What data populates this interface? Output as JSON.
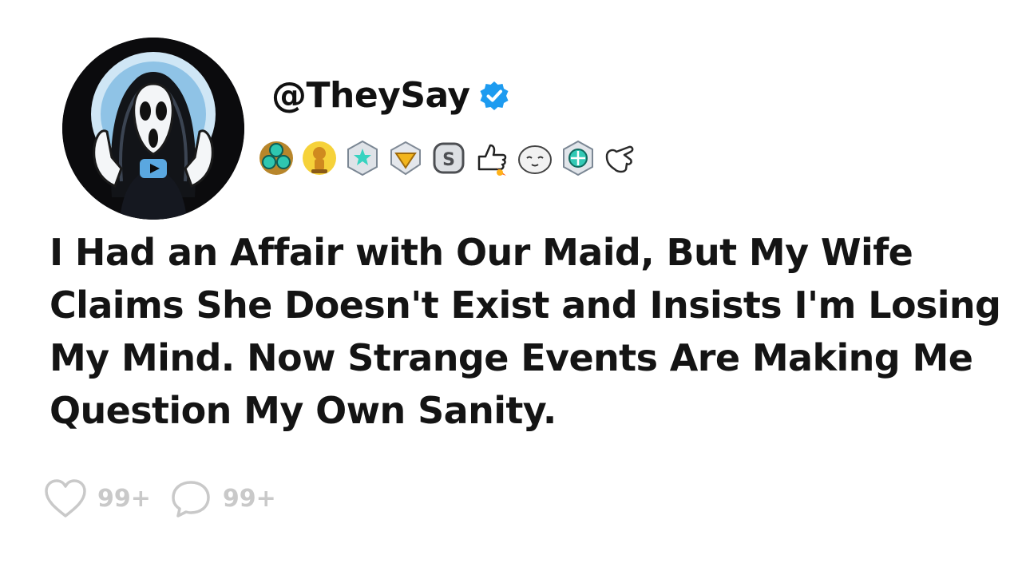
{
  "post": {
    "handle": "@TheySay",
    "verified": true,
    "title": "I Had an Affair with Our Maid, But My Wife Claims She Doesn't Exist and Insists I'm Losing My Mind. Now Strange Events Are Making Me Question My Own Sanity."
  },
  "avatar": {
    "icon": "ghostface-youtube-avatar-icon"
  },
  "awards": [
    "tri-gem-award-icon",
    "gold-snoo-trophy-award-icon",
    "silver-star-gem-award-icon",
    "gold-diamond-award-icon",
    "silver-s-coin-award-icon",
    "thumbs-up-rocket-award-icon",
    "seal-face-award-icon",
    "silver-compass-gem-award-icon",
    "white-glove-point-award-icon"
  ],
  "stats": {
    "likes": "99+",
    "comments": "99+"
  },
  "colors": {
    "verified_blue": "#1d9bf0",
    "stat_gray": "#c9c9c9",
    "text": "#141414"
  }
}
